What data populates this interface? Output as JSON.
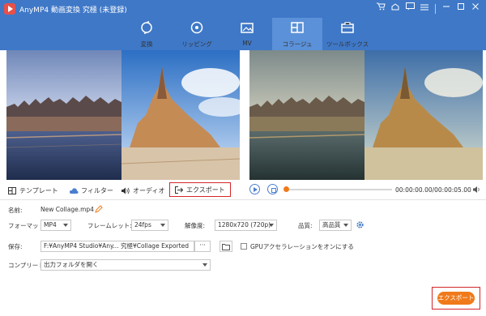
{
  "app": {
    "title": "AnyMP4 動画変換 究極 (未登録)"
  },
  "nav": {
    "tabs": [
      {
        "label": "変換",
        "icon": "convert-icon"
      },
      {
        "label": "リッピング",
        "icon": "ripper-icon"
      },
      {
        "label": "MV",
        "icon": "mv-icon"
      },
      {
        "label": "コラージュ",
        "icon": "collage-icon",
        "active": true
      },
      {
        "label": "ツールボックス",
        "icon": "toolbox-icon"
      }
    ]
  },
  "tabs": {
    "template": "テンプレート",
    "filter": "フィルター",
    "audio": "オーディオ",
    "export": "エクスポート"
  },
  "player": {
    "time": "00:00:00.00/00:00:05.00"
  },
  "form": {
    "name_label": "名前:",
    "name_value": "New Collage.mp4",
    "format_label": "フォーマット:",
    "format_value": "MP4",
    "framerate_label": "フレームレット:",
    "framerate_value": "24fps",
    "resolution_label": "解像度:",
    "resolution_value": "1280x720 (720p)",
    "quality_label": "品質:",
    "quality_value": "高品質",
    "save_label": "保存:",
    "save_path": "F:¥AnyMP4 Studio¥Any... 究極¥Collage Exported",
    "browse_label": "···",
    "gpu_label": "GPUアクセラレーションをオンにする",
    "complete_label": "コンプリート:",
    "complete_value": "出力フォルダを開く"
  },
  "export_button": "エクスポート",
  "colors": {
    "accent": "#3f78c7",
    "orange": "#f07a1a",
    "highlight": "#d4262b"
  }
}
